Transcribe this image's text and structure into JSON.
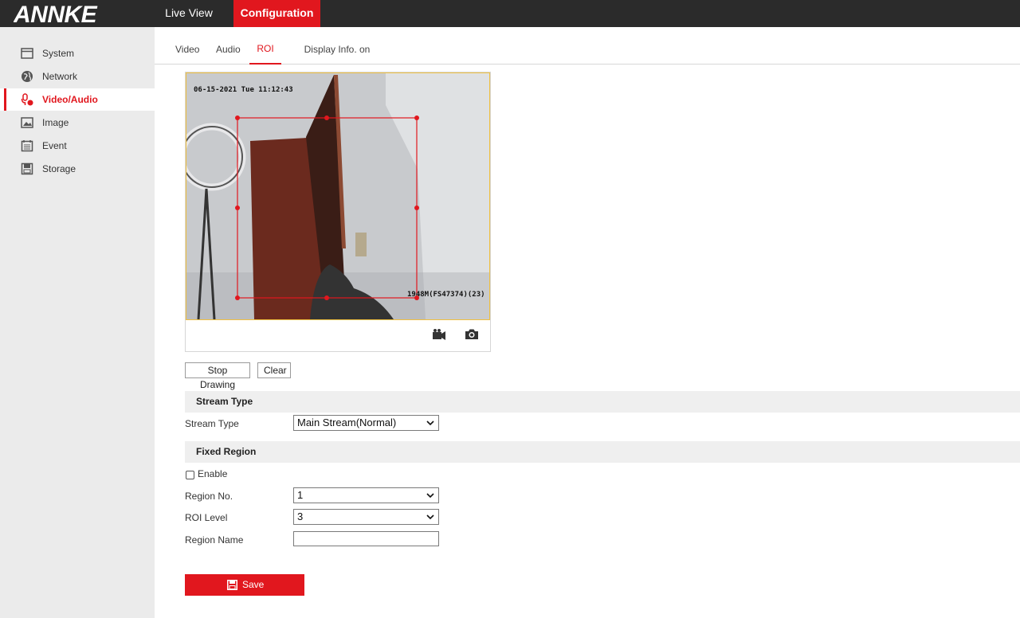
{
  "brand": {
    "logo_text": "ANNKE",
    "accent": "#e1171e",
    "topbar_color": "#2b2b2b"
  },
  "topnav": {
    "live_view": "Live View",
    "configuration": "Configuration"
  },
  "sidebar": {
    "items": [
      {
        "label": "System",
        "icon": "system-icon"
      },
      {
        "label": "Network",
        "icon": "network-icon"
      },
      {
        "label": "Video/Audio",
        "icon": "video-audio-icon",
        "active": true
      },
      {
        "label": "Image",
        "icon": "image-icon"
      },
      {
        "label": "Event",
        "icon": "event-icon"
      },
      {
        "label": "Storage",
        "icon": "storage-icon"
      }
    ]
  },
  "tabs": [
    {
      "label": "Video"
    },
    {
      "label": "Audio"
    },
    {
      "label": "ROI",
      "active": true
    },
    {
      "label": "Display Info. on Stream"
    }
  ],
  "video": {
    "osd_time": "06-15-2021 Tue 11:12:43",
    "osd_name": "1948M(FS47374)(23)",
    "tools": [
      "record-icon",
      "snapshot-icon"
    ]
  },
  "actions": {
    "stop_drawing": "Stop Drawing",
    "clear": "Clear"
  },
  "stream_section": {
    "title": "Stream Type",
    "stream_type_label": "Stream Type",
    "stream_type_value": "Main Stream(Normal)"
  },
  "fixed_region": {
    "title": "Fixed Region",
    "enable_label": "Enable",
    "enable_checked": false,
    "region_no_label": "Region No.",
    "region_no_value": "1",
    "roi_level_label": "ROI Level",
    "roi_level_value": "3",
    "region_name_label": "Region Name",
    "region_name_value": ""
  },
  "save": {
    "label": "Save"
  }
}
